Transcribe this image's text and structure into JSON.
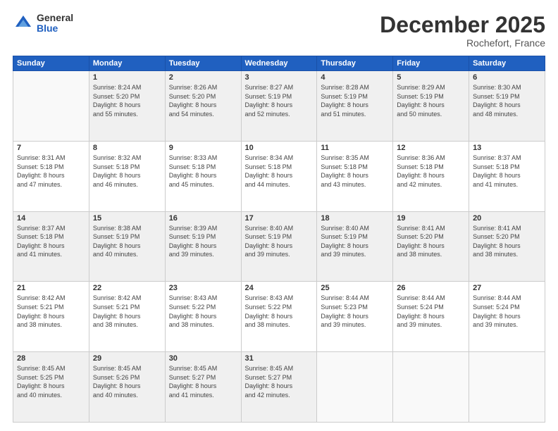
{
  "logo": {
    "general": "General",
    "blue": "Blue"
  },
  "header": {
    "month": "December 2025",
    "location": "Rochefort, France"
  },
  "weekdays": [
    "Sunday",
    "Monday",
    "Tuesday",
    "Wednesday",
    "Thursday",
    "Friday",
    "Saturday"
  ],
  "weeks": [
    [
      {
        "day": "",
        "info": ""
      },
      {
        "day": "1",
        "info": "Sunrise: 8:24 AM\nSunset: 5:20 PM\nDaylight: 8 hours\nand 55 minutes."
      },
      {
        "day": "2",
        "info": "Sunrise: 8:26 AM\nSunset: 5:20 PM\nDaylight: 8 hours\nand 54 minutes."
      },
      {
        "day": "3",
        "info": "Sunrise: 8:27 AM\nSunset: 5:19 PM\nDaylight: 8 hours\nand 52 minutes."
      },
      {
        "day": "4",
        "info": "Sunrise: 8:28 AM\nSunset: 5:19 PM\nDaylight: 8 hours\nand 51 minutes."
      },
      {
        "day": "5",
        "info": "Sunrise: 8:29 AM\nSunset: 5:19 PM\nDaylight: 8 hours\nand 50 minutes."
      },
      {
        "day": "6",
        "info": "Sunrise: 8:30 AM\nSunset: 5:19 PM\nDaylight: 8 hours\nand 48 minutes."
      }
    ],
    [
      {
        "day": "7",
        "info": "Sunrise: 8:31 AM\nSunset: 5:18 PM\nDaylight: 8 hours\nand 47 minutes."
      },
      {
        "day": "8",
        "info": "Sunrise: 8:32 AM\nSunset: 5:18 PM\nDaylight: 8 hours\nand 46 minutes."
      },
      {
        "day": "9",
        "info": "Sunrise: 8:33 AM\nSunset: 5:18 PM\nDaylight: 8 hours\nand 45 minutes."
      },
      {
        "day": "10",
        "info": "Sunrise: 8:34 AM\nSunset: 5:18 PM\nDaylight: 8 hours\nand 44 minutes."
      },
      {
        "day": "11",
        "info": "Sunrise: 8:35 AM\nSunset: 5:18 PM\nDaylight: 8 hours\nand 43 minutes."
      },
      {
        "day": "12",
        "info": "Sunrise: 8:36 AM\nSunset: 5:18 PM\nDaylight: 8 hours\nand 42 minutes."
      },
      {
        "day": "13",
        "info": "Sunrise: 8:37 AM\nSunset: 5:18 PM\nDaylight: 8 hours\nand 41 minutes."
      }
    ],
    [
      {
        "day": "14",
        "info": "Sunrise: 8:37 AM\nSunset: 5:18 PM\nDaylight: 8 hours\nand 41 minutes."
      },
      {
        "day": "15",
        "info": "Sunrise: 8:38 AM\nSunset: 5:19 PM\nDaylight: 8 hours\nand 40 minutes."
      },
      {
        "day": "16",
        "info": "Sunrise: 8:39 AM\nSunset: 5:19 PM\nDaylight: 8 hours\nand 39 minutes."
      },
      {
        "day": "17",
        "info": "Sunrise: 8:40 AM\nSunset: 5:19 PM\nDaylight: 8 hours\nand 39 minutes."
      },
      {
        "day": "18",
        "info": "Sunrise: 8:40 AM\nSunset: 5:19 PM\nDaylight: 8 hours\nand 39 minutes."
      },
      {
        "day": "19",
        "info": "Sunrise: 8:41 AM\nSunset: 5:20 PM\nDaylight: 8 hours\nand 38 minutes."
      },
      {
        "day": "20",
        "info": "Sunrise: 8:41 AM\nSunset: 5:20 PM\nDaylight: 8 hours\nand 38 minutes."
      }
    ],
    [
      {
        "day": "21",
        "info": "Sunrise: 8:42 AM\nSunset: 5:21 PM\nDaylight: 8 hours\nand 38 minutes."
      },
      {
        "day": "22",
        "info": "Sunrise: 8:42 AM\nSunset: 5:21 PM\nDaylight: 8 hours\nand 38 minutes."
      },
      {
        "day": "23",
        "info": "Sunrise: 8:43 AM\nSunset: 5:22 PM\nDaylight: 8 hours\nand 38 minutes."
      },
      {
        "day": "24",
        "info": "Sunrise: 8:43 AM\nSunset: 5:22 PM\nDaylight: 8 hours\nand 38 minutes."
      },
      {
        "day": "25",
        "info": "Sunrise: 8:44 AM\nSunset: 5:23 PM\nDaylight: 8 hours\nand 39 minutes."
      },
      {
        "day": "26",
        "info": "Sunrise: 8:44 AM\nSunset: 5:24 PM\nDaylight: 8 hours\nand 39 minutes."
      },
      {
        "day": "27",
        "info": "Sunrise: 8:44 AM\nSunset: 5:24 PM\nDaylight: 8 hours\nand 39 minutes."
      }
    ],
    [
      {
        "day": "28",
        "info": "Sunrise: 8:45 AM\nSunset: 5:25 PM\nDaylight: 8 hours\nand 40 minutes."
      },
      {
        "day": "29",
        "info": "Sunrise: 8:45 AM\nSunset: 5:26 PM\nDaylight: 8 hours\nand 40 minutes."
      },
      {
        "day": "30",
        "info": "Sunrise: 8:45 AM\nSunset: 5:27 PM\nDaylight: 8 hours\nand 41 minutes."
      },
      {
        "day": "31",
        "info": "Sunrise: 8:45 AM\nSunset: 5:27 PM\nDaylight: 8 hours\nand 42 minutes."
      },
      {
        "day": "",
        "info": ""
      },
      {
        "day": "",
        "info": ""
      },
      {
        "day": "",
        "info": ""
      }
    ]
  ]
}
